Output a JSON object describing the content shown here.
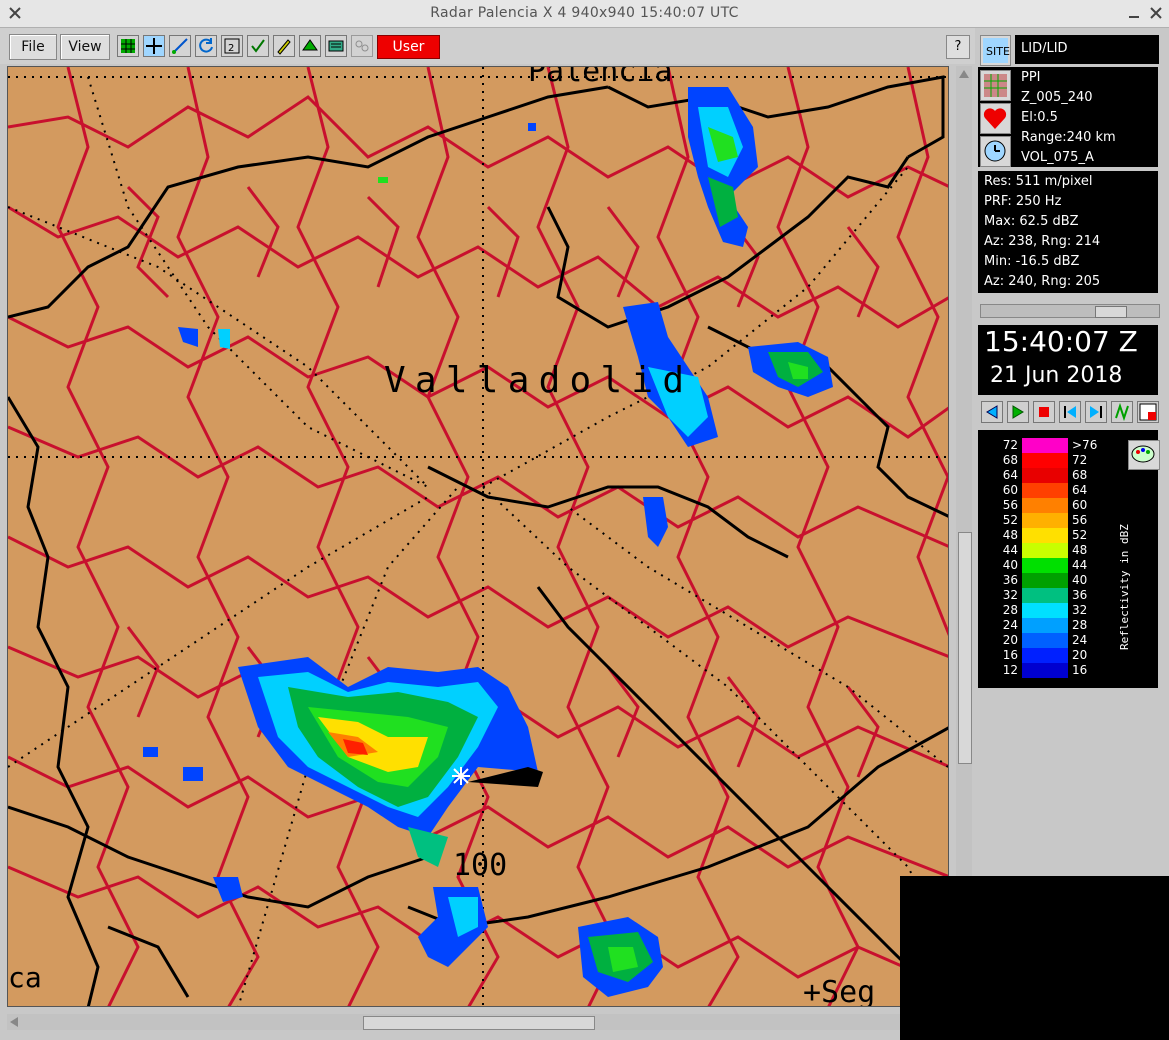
{
  "window": {
    "title": "Radar Palencia  X 4  940x940   15:40:07 UTC"
  },
  "toolbar": {
    "file_label": "File",
    "view_label": "View",
    "user_label": "User",
    "help_label": "?"
  },
  "map": {
    "labels": [
      {
        "id": "valladolid",
        "text": "Valladolid"
      },
      {
        "id": "ring100",
        "text": "100"
      },
      {
        "id": "segovia",
        "text": "+Seg"
      },
      {
        "id": "ca",
        "text": "ca"
      },
      {
        "id": "topcut",
        "text": "Palencia"
      }
    ]
  },
  "side": {
    "source_label": "LID/LID",
    "product": {
      "type": "PPI",
      "name": "Z_005_240",
      "elevation": "El:0.5",
      "range": "Range:240 km",
      "volume": "VOL_075_A"
    },
    "stats": [
      "Res: 511 m/pixel",
      "PRF: 250 Hz",
      "Max: 62.5 dBZ",
      "Az:  238, Rng: 214",
      "Min: -16.5 dBZ",
      "Az:  240, Rng: 205"
    ],
    "clock": {
      "time": "15:40:07 Z",
      "date": "21 Jun 2018"
    },
    "legend": {
      "title": "Reflectivity in dBZ",
      "left_ticks": [
        "72",
        "68",
        "64",
        "60",
        "56",
        "52",
        "48",
        "44",
        "40",
        "36",
        "32",
        "28",
        "24",
        "20",
        "16",
        "12"
      ],
      "right_ticks": [
        ">76",
        "72",
        "68",
        "64",
        "60",
        "56",
        "52",
        "48",
        "44",
        "40",
        "36",
        "32",
        "28",
        "24",
        "20",
        "16"
      ],
      "colors": [
        "#ff00c8",
        "#ff0000",
        "#e80000",
        "#ff4000",
        "#ff8000",
        "#ffb000",
        "#ffe000",
        "#c8ff00",
        "#00e000",
        "#00a000",
        "#00c080",
        "#00e0ff",
        "#00a0ff",
        "#0060ff",
        "#0020ff",
        "#0000d0"
      ]
    }
  },
  "colors": {
    "map_bg": "#d39a5f",
    "border_red": "#c8102e",
    "border_black": "#000000",
    "user_button": "#ee0000"
  }
}
